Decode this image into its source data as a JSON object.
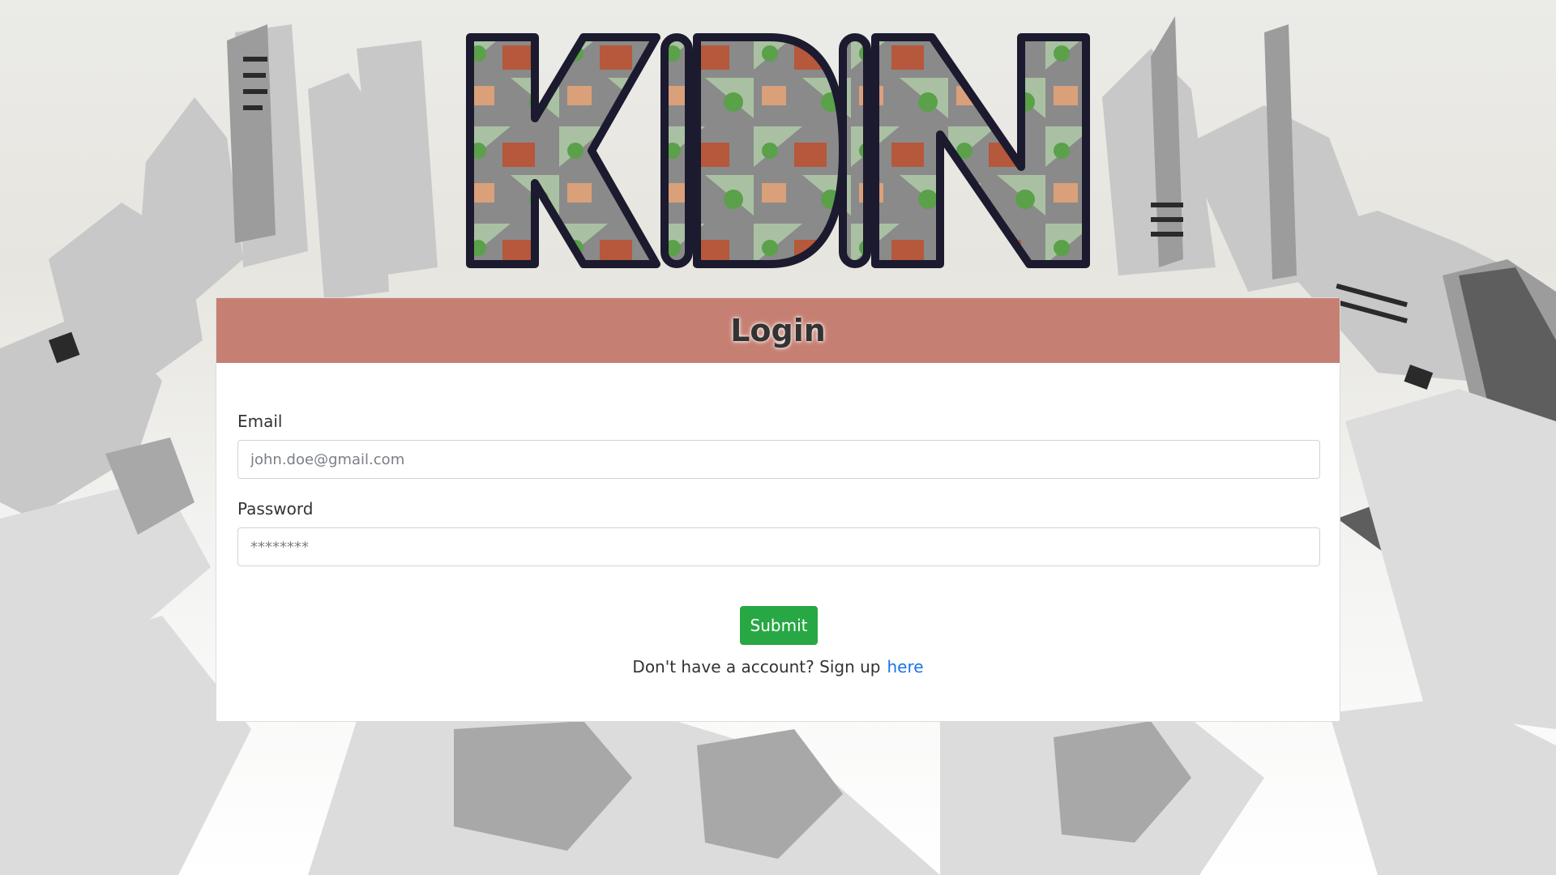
{
  "colors": {
    "header_bg": "#c68073",
    "submit_bg": "#28a745",
    "link": "#1a73e8"
  },
  "logo": {
    "letters": "KIDIN",
    "icon": "kidin-logo-image"
  },
  "login": {
    "title": "Login",
    "email_label": "Email",
    "email_placeholder": "john.doe@gmail.com",
    "password_label": "Password",
    "password_placeholder": "********",
    "submit_label": "Submit",
    "signup_text": "Don't have a account? Sign up",
    "signup_link": "here"
  }
}
